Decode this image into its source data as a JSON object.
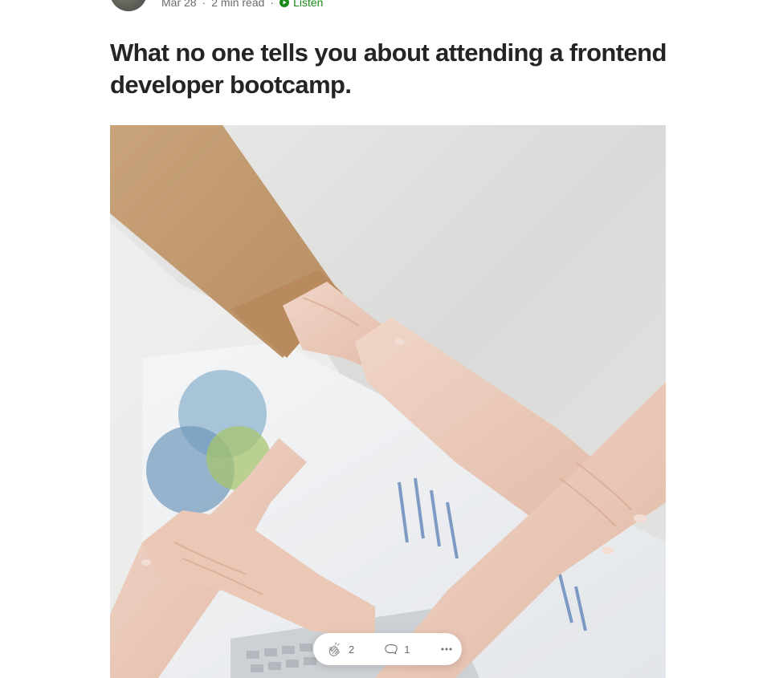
{
  "byline": {
    "date": "Mar 28",
    "read_time": "2 min read",
    "separator": "·",
    "listen_label": "Listen"
  },
  "article": {
    "title": "What no one tells you about attending a frontend developer bootcamp."
  },
  "hero_image": {
    "subject": "four hands holding wrists in a square over a desk with charts"
  },
  "action_bar": {
    "claps": "2",
    "responses": "1",
    "more_icon": "more-horizontal-icon",
    "clap_icon": "clap-icon",
    "response_icon": "speech-bubble-icon"
  },
  "colors": {
    "accent_green": "#1a8917",
    "text_primary": "#242424",
    "text_secondary": "#6b6b6b"
  }
}
